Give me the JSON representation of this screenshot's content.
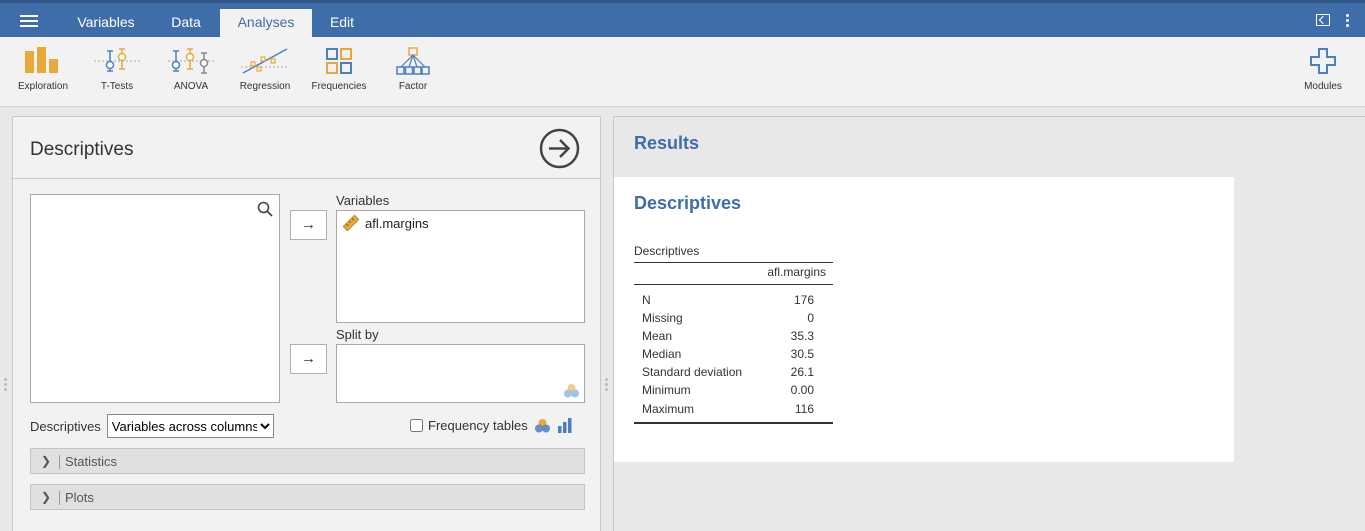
{
  "topbar": {
    "tabs": [
      {
        "label": "Variables",
        "active": false
      },
      {
        "label": "Data",
        "active": false
      },
      {
        "label": "Analyses",
        "active": true
      },
      {
        "label": "Edit",
        "active": false
      }
    ]
  },
  "ribbon": {
    "items": [
      {
        "label": "Exploration",
        "icon": "exploration-icon"
      },
      {
        "label": "T-Tests",
        "icon": "t-tests-icon"
      },
      {
        "label": "ANOVA",
        "icon": "anova-icon"
      },
      {
        "label": "Regression",
        "icon": "regression-icon"
      },
      {
        "label": "Frequencies",
        "icon": "frequencies-icon"
      },
      {
        "label": "Factor",
        "icon": "factor-icon"
      }
    ],
    "modules_label": "Modules"
  },
  "options": {
    "title": "Descriptives",
    "variables_label": "Variables",
    "variables": [
      "afl.margins"
    ],
    "split_by_label": "Split by",
    "descriptives_label": "Descriptives",
    "descriptives_select": "Variables across columns",
    "frequency_tables_label": "Frequency tables",
    "sections": [
      "Statistics",
      "Plots"
    ]
  },
  "results": {
    "title": "Results",
    "heading": "Descriptives",
    "table_caption": "Descriptives",
    "column_header": "afl.margins",
    "rows": [
      {
        "label": "N",
        "value": "176"
      },
      {
        "label": "Missing",
        "value": "0"
      },
      {
        "label": "Mean",
        "value": "35.3"
      },
      {
        "label": "Median",
        "value": "30.5"
      },
      {
        "label": "Standard deviation",
        "value": "26.1"
      },
      {
        "label": "Minimum",
        "value": "0.00"
      },
      {
        "label": "Maximum",
        "value": "116"
      }
    ]
  },
  "colors": {
    "accent": "#3e6da9",
    "icon_orange": "#e9a93a",
    "icon_blue": "#4a7fc1"
  }
}
